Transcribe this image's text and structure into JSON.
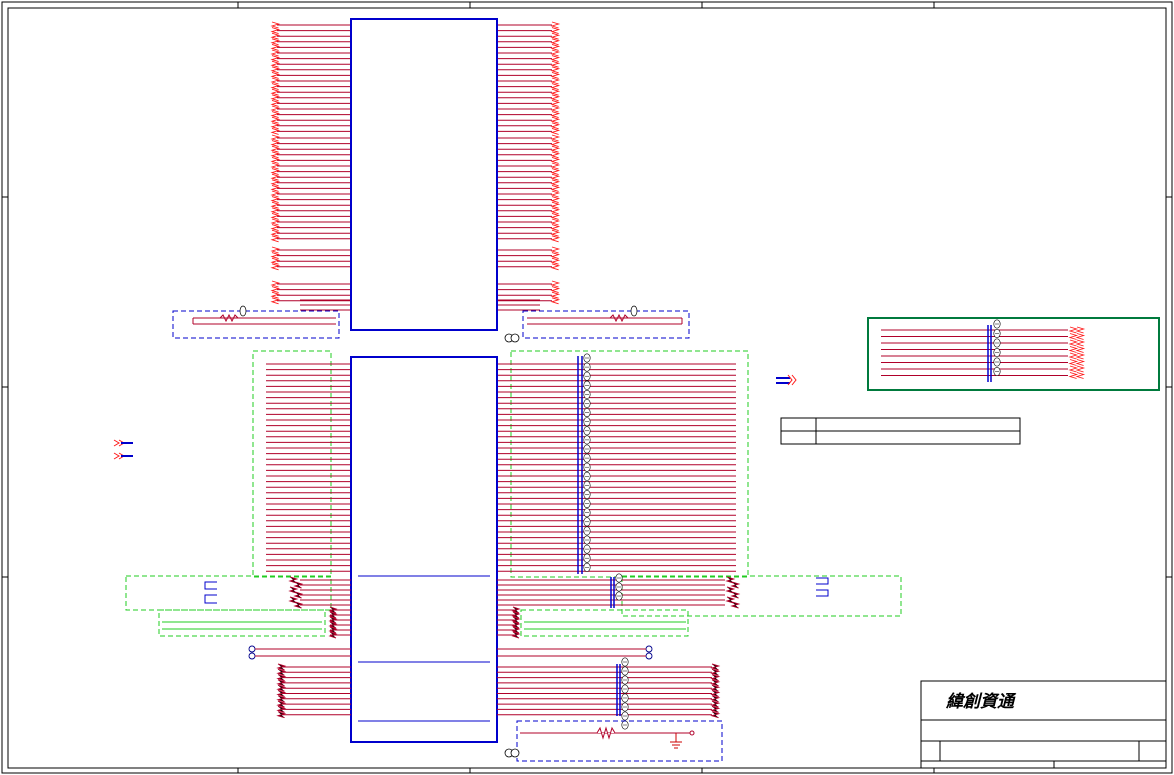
{
  "title_block": {
    "company": "緯創資通"
  },
  "colors": {
    "net": "#b0002a",
    "zigzag": "#ff1a1a",
    "component": "#0000cc",
    "dashed_blue": "#0000cc",
    "dashed_green": "#22cc22",
    "border_green": "#007a3d",
    "frame": "#000000",
    "ground": "#cc0000"
  },
  "icons": [
    "net-label-icon",
    "capacitor-icon",
    "resistor-icon",
    "ground-icon",
    "test-point-icon",
    "power-flag-icon"
  ]
}
